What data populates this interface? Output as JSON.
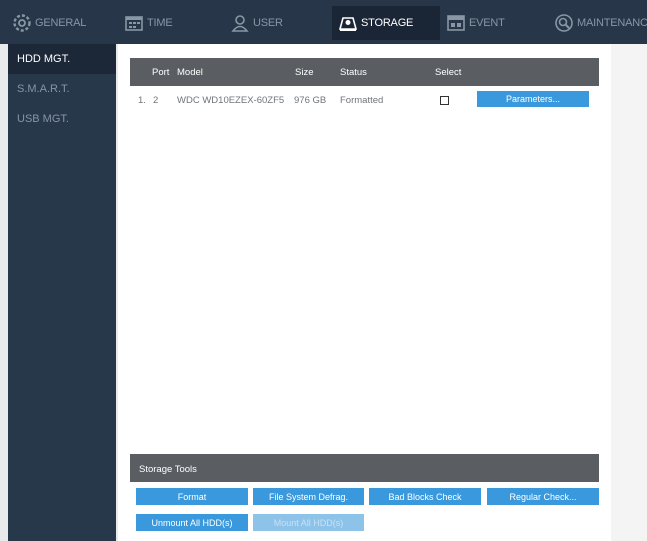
{
  "nav": {
    "tabs": [
      {
        "label": "GENERAL",
        "icon": "gear-icon"
      },
      {
        "label": "TIME",
        "icon": "calendar-icon"
      },
      {
        "label": "USER",
        "icon": "user-icon"
      },
      {
        "label": "STORAGE",
        "icon": "storage-icon",
        "active": true
      },
      {
        "label": "EVENT",
        "icon": "event-icon"
      },
      {
        "label": "MAINTENANCE",
        "icon": "wrench-icon"
      }
    ]
  },
  "sidebar": {
    "items": [
      {
        "label": "HDD MGT.",
        "active": true
      },
      {
        "label": "S.M.A.R.T."
      },
      {
        "label": "USB MGT."
      }
    ]
  },
  "table": {
    "headers": {
      "port": "Port",
      "model": "Model",
      "size": "Size",
      "status": "Status",
      "select": "Select"
    },
    "rows": [
      {
        "index": "1.",
        "port": "2",
        "model": "WDC WD10EZEX-60ZF5",
        "size": "976 GB",
        "status": "Formatted",
        "selected": false,
        "action_label": "Parameters..."
      }
    ]
  },
  "tools": {
    "title": "Storage Tools",
    "format_label": "Format",
    "defrag_label": "File System Defrag.",
    "bad_blocks_label": "Bad Blocks Check",
    "regular_check_label": "Regular Check...",
    "unmount_label": "Unmount All HDD(s)",
    "mount_label": "Mount All HDD(s)"
  },
  "colors": {
    "nav_bg": "#273648",
    "accent_button": "#3a99dd",
    "table_header": "#5a5e63"
  }
}
